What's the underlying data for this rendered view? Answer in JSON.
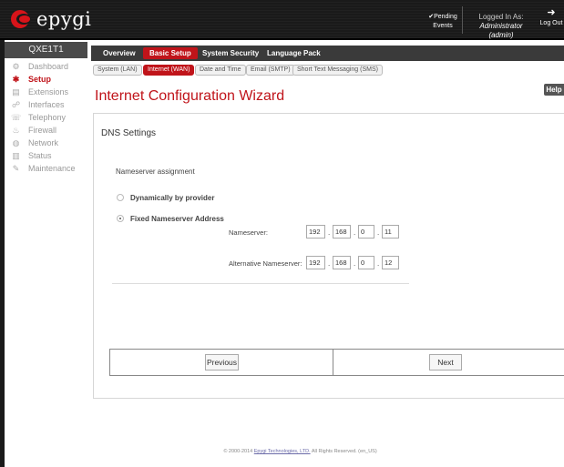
{
  "header": {
    "logo_text": "epygi",
    "pending_line1": "✔Pending",
    "pending_line2": "Events",
    "logged_in_label": "Logged In As:",
    "logged_in_user": "Administrator (admin)",
    "logout_label": "Log Out"
  },
  "sidebar": {
    "device": "QXE1T1",
    "items": [
      {
        "label": "Dashboard",
        "icon": "dashboard-icon"
      },
      {
        "label": "Setup",
        "icon": "gear-icon"
      },
      {
        "label": "Extensions",
        "icon": "extensions-icon"
      },
      {
        "label": "Interfaces",
        "icon": "interfaces-icon"
      },
      {
        "label": "Telephony",
        "icon": "phone-icon"
      },
      {
        "label": "Firewall",
        "icon": "fire-icon"
      },
      {
        "label": "Network",
        "icon": "globe-icon"
      },
      {
        "label": "Status",
        "icon": "chart-icon"
      },
      {
        "label": "Maintenance",
        "icon": "wrench-icon"
      }
    ]
  },
  "main_tabs": [
    "Overview",
    "Basic Setup",
    "System Security",
    "Language Pack"
  ],
  "sub_tabs": [
    "System (LAN)",
    "Internet (WAN)",
    "Date and Time",
    "Email (SMTP)",
    "Short Text Messaging (SMS)"
  ],
  "help_label": "Help",
  "page_title": "Internet Configuration Wizard",
  "section_title": "DNS Settings",
  "form": {
    "assignment_label": "Nameserver assignment",
    "option_dynamic": "Dynamically by provider",
    "option_fixed": "Fixed Nameserver Address",
    "nameserver_label": "Nameserver:",
    "nameserver": [
      "192",
      "168",
      "0",
      "11"
    ],
    "alt_nameserver_label": "Alternative Nameserver:",
    "alt_nameserver": [
      "192",
      "168",
      "0",
      "12"
    ],
    "selected": "fixed"
  },
  "buttons": {
    "previous": "Previous",
    "next": "Next"
  },
  "footer": {
    "prefix": "© 2000-2014",
    "link": "Epygi Technologies, LTD.",
    "suffix": "All Rights Reserved. (en_US)"
  }
}
